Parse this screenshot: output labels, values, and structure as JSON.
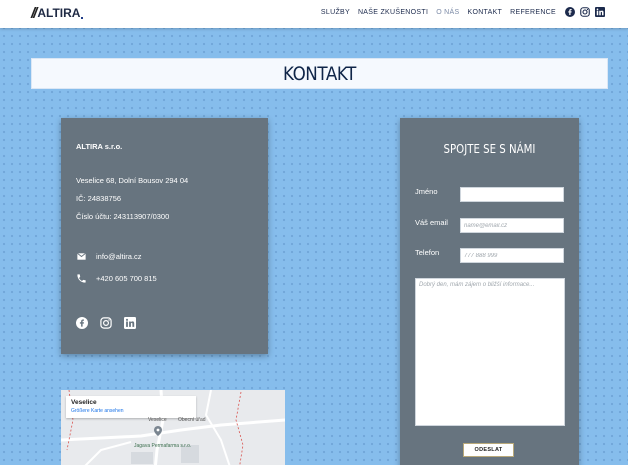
{
  "header": {
    "logo_text": "ALTIRA",
    "nav": [
      {
        "label": "Služby",
        "active": false
      },
      {
        "label": "Naše zkušenosti",
        "active": false
      },
      {
        "label": "O nás",
        "active": true
      },
      {
        "label": "Kontakt",
        "active": false
      },
      {
        "label": "Reference",
        "active": false
      }
    ],
    "social_icons": [
      "facebook-icon",
      "instagram-icon",
      "linkedin-icon"
    ]
  },
  "page": {
    "title": "KONTAKT"
  },
  "info": {
    "company": "ALTIRA s.r.o.",
    "address": "Veselice 68, Dolní Bousov 294 04",
    "ico": "IČ: 24838756",
    "account": "Číslo účtu: 243113907/0300",
    "email": "info@altira.cz",
    "phone": "+420 605 700 815",
    "social_icons": [
      "facebook-icon",
      "instagram-icon",
      "linkedin-icon"
    ]
  },
  "form": {
    "title": "SPOJTE SE S NÁMI",
    "name_label": "Jméno",
    "name_value": "",
    "email_label": "Váš email",
    "email_placeholder": "name@email.cz",
    "phone_label": "Telefon",
    "phone_placeholder": "777 888 999",
    "message_placeholder": "Dobrý den, mám zájem o bližší informace...",
    "submit_label": "ODESLAT"
  },
  "map": {
    "place_name": "Veselice",
    "link_text": "Größere Karte ansehen",
    "label_office": "Obecní úřad",
    "label_farm": "Jagava Permafarma s.r.o.",
    "label_veselice": "Veselice"
  },
  "colors": {
    "background": "#86bdec",
    "card": "#67747f",
    "title": "#0f2548"
  }
}
